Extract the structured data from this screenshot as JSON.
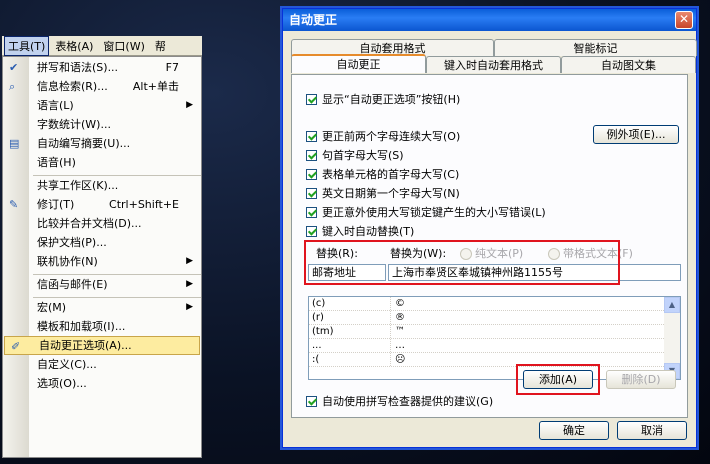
{
  "menubar": {
    "items": [
      {
        "label": "工具(T)",
        "active": true
      },
      {
        "label": "表格(A)",
        "active": false
      },
      {
        "label": "窗口(W)",
        "active": false
      },
      {
        "label": "帮",
        "active": false
      }
    ]
  },
  "tools_menu": {
    "items": [
      {
        "label": "拼写和语法(S)...",
        "shortcut": "F7",
        "icon": "spellcheck-icon"
      },
      {
        "label": "信息检索(R)...",
        "shortcut": "Alt+单击",
        "icon": "research-icon"
      },
      {
        "label": "语言(L)",
        "submenu": true
      },
      {
        "label": "字数统计(W)..."
      },
      {
        "label": "自动编写摘要(U)...",
        "icon": "autosummary-icon"
      },
      {
        "label": "语音(H)"
      },
      {
        "label": "共享工作区(K)...",
        "separator": true
      },
      {
        "label": "修订(T)",
        "shortcut": "Ctrl+Shift+E",
        "icon": "track-changes-icon"
      },
      {
        "label": "比较并合并文档(D)..."
      },
      {
        "label": "保护文档(P)..."
      },
      {
        "label": "联机协作(N)",
        "submenu": true
      },
      {
        "label": "信函与邮件(E)",
        "submenu": true,
        "separator": true
      },
      {
        "label": "宏(M)",
        "submenu": true,
        "separator": true
      },
      {
        "label": "模板和加载项(I)..."
      },
      {
        "label": "自动更正选项(A)...",
        "highlight": true,
        "icon": "autocorrect-icon"
      },
      {
        "label": "自定义(C)..."
      },
      {
        "label": "选项(O)..."
      }
    ]
  },
  "dialog": {
    "title": "自动更正",
    "close_glyph": "✕",
    "tabs_row1": [
      "自动套用格式",
      "智能标记"
    ],
    "tabs_row2": [
      "自动更正",
      "键入时自动套用格式",
      "自动图文集"
    ],
    "checkboxes": [
      {
        "label": "显示“自动更正选项”按钮(H)",
        "checked": true
      },
      {
        "label": "更正前两个字母连续大写(O)",
        "checked": true
      },
      {
        "label": "句首字母大写(S)",
        "checked": true
      },
      {
        "label": "表格单元格的首字母大写(C)",
        "checked": true
      },
      {
        "label": "英文日期第一个字母大写(N)",
        "checked": true
      },
      {
        "label": "更正意外使用大写锁定键产生的大小写错误(L)",
        "checked": true
      },
      {
        "label": "键入时自动替换(T)",
        "checked": true
      }
    ],
    "exceptions_button": "例外项(E)...",
    "replace_label": "替换(R):",
    "with_label": "替换为(W):",
    "plain_text_label": "纯文本(P)",
    "formatted_text_label": "带格式文本(F)",
    "replace_value": "邮寄地址",
    "with_value": "上海市奉贤区奉城镇神州路1155号",
    "entries": [
      {
        "from": "(c)",
        "to": "©"
      },
      {
        "from": "(r)",
        "to": "®"
      },
      {
        "from": "(tm)",
        "to": "™"
      },
      {
        "from": "...",
        "to": "…"
      },
      {
        "from": ":(",
        "to": "☹"
      }
    ],
    "add_button": "添加(A)",
    "delete_button": "删除(D)",
    "spell_suggest_label": "自动使用拼写检查器提供的建议(G)",
    "ok_button": "确定",
    "cancel_button": "取消"
  }
}
